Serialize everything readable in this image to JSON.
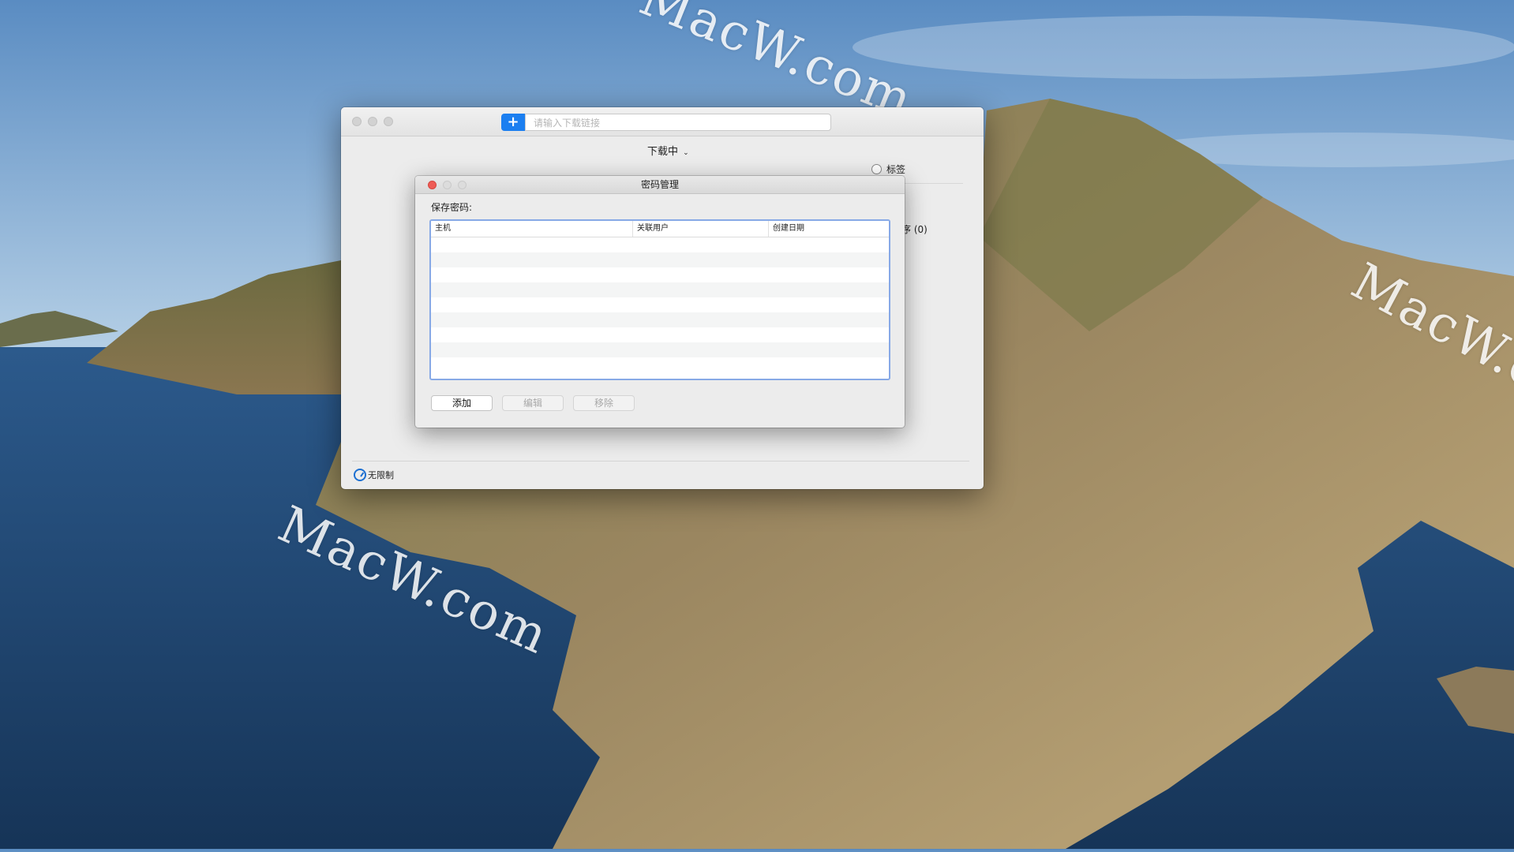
{
  "main_window": {
    "url_placeholder": "请输入下载链接",
    "add_label": "+",
    "status_filter": "下载中",
    "tags_label": "标签",
    "tag_fragments": [
      ")",
      ")",
      "序 (0)",
      ")"
    ],
    "speed_label": "无限制"
  },
  "dialog": {
    "title": "密码管理",
    "section_label": "保存密码:",
    "columns": [
      "主机",
      "关联用户",
      "创建日期"
    ],
    "buttons": {
      "add": "添加",
      "edit": "编辑",
      "remove": "移除"
    }
  },
  "watermarks": [
    "MacW.com",
    "MacW.com",
    "MacW.com"
  ],
  "colors": {
    "accent": "#1c7ff0",
    "close_red": "#ee5b55",
    "focus_ring": "#87a9e6"
  }
}
